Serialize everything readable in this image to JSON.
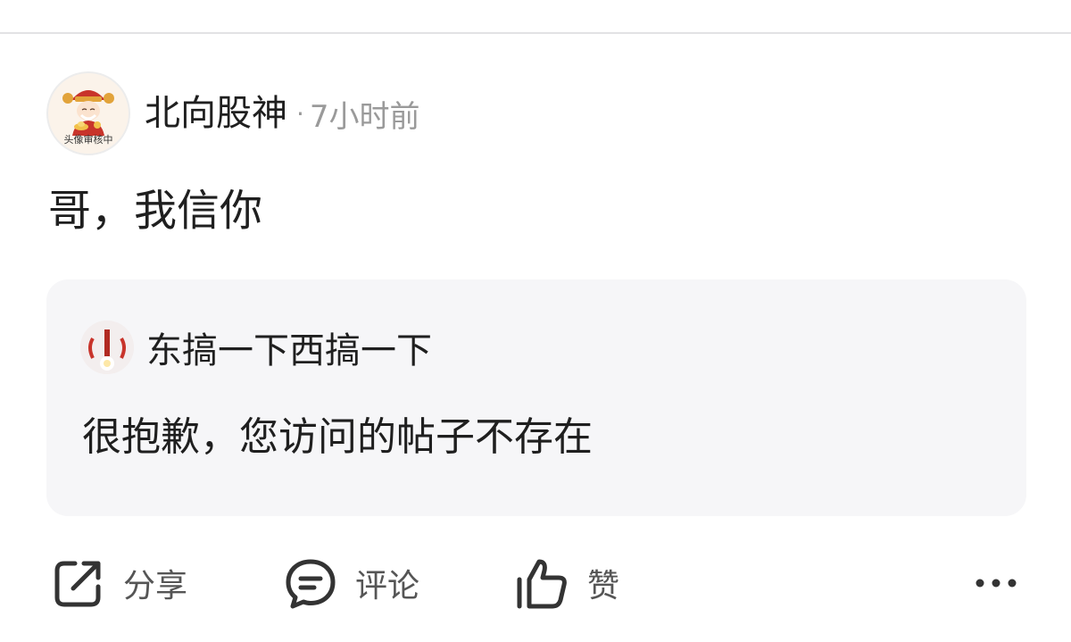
{
  "post": {
    "author": {
      "name": "北向股神",
      "separator": "·",
      "time": "7小时前",
      "avatar_caption": "头像审核中"
    },
    "content": "哥，我信你",
    "quoted": {
      "username": "东搞一下西搞一下",
      "text": "很抱歉，您访问的帖子不存在"
    }
  },
  "actions": {
    "share": "分享",
    "comment": "评论",
    "like": "赞"
  },
  "colors": {
    "text_primary": "#1f1f1f",
    "text_secondary": "#9a9a9a",
    "card_bg": "#f6f6f8",
    "icon": "#333333"
  }
}
